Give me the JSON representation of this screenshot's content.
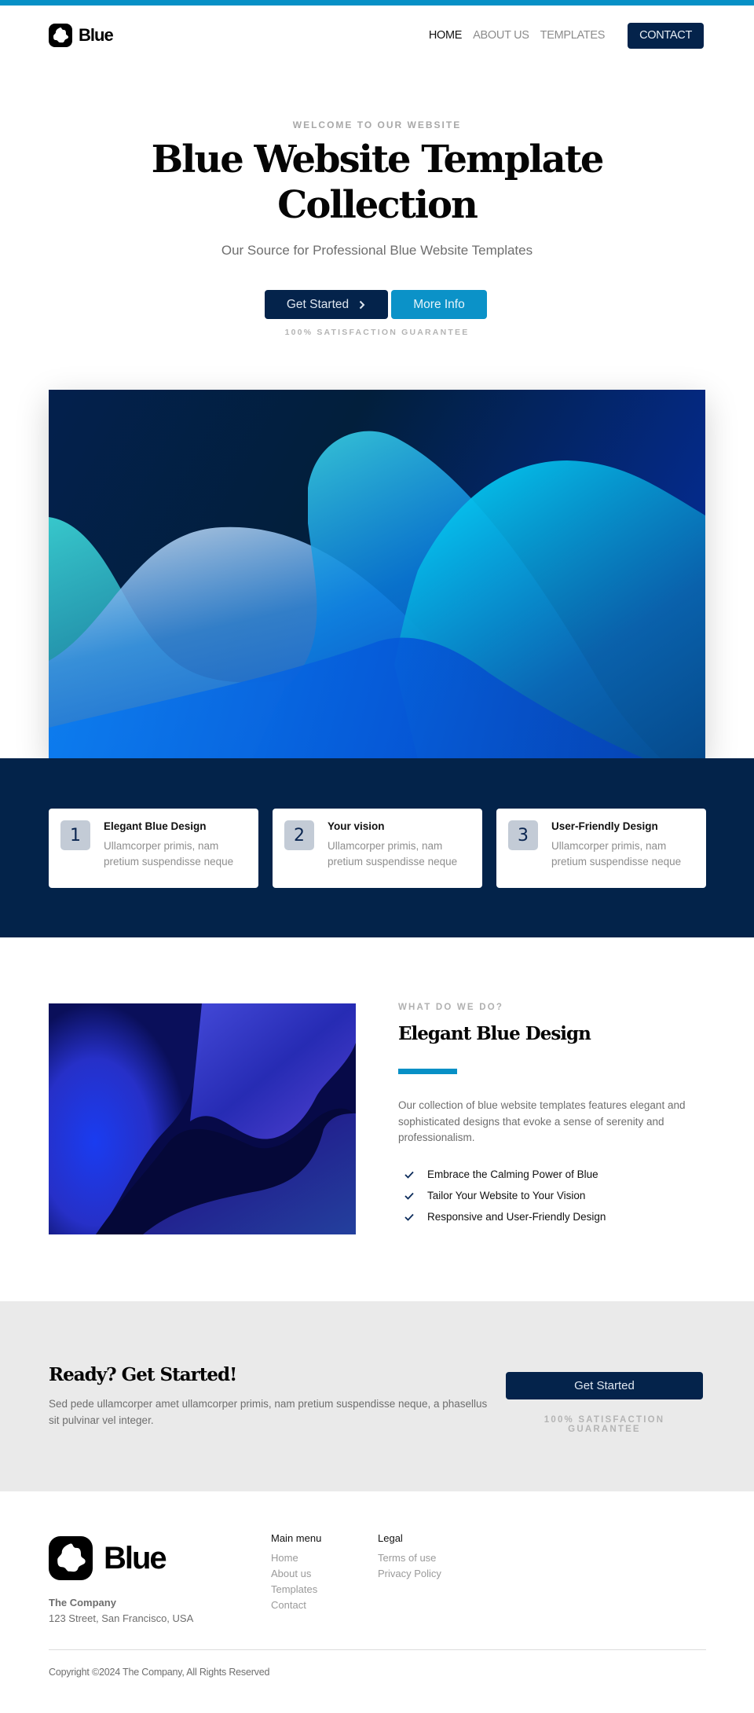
{
  "colors": {
    "accent": "#0790c6",
    "navy": "#04234b",
    "band": "#03234a",
    "cta_bg": "#eaeaea"
  },
  "header": {
    "logo_text": "Blue",
    "logo_icon": "logo-mark-icon",
    "nav": [
      {
        "label": "HOME",
        "active": true
      },
      {
        "label": "ABOUT US",
        "active": false
      },
      {
        "label": "TEMPLATES",
        "active": false
      }
    ],
    "contact_label": "CONTACT"
  },
  "hero": {
    "eyebrow": "WELCOME TO OUR WEBSITE",
    "title_line1": "Blue Website Template",
    "title_line2": "Collection",
    "subtitle": "Our Source for Professional Blue Website Templates",
    "primary_button": "Get Started",
    "primary_icon": "chevron-right-icon",
    "secondary_button": "More Info",
    "guarantee": "100% SATISFACTION GUARANTEE"
  },
  "features": [
    {
      "number": "1",
      "title": "Elegant Blue Design",
      "description": "Ullamcorper primis, nam pretium suspendisse neque"
    },
    {
      "number": "2",
      "title": "Your vision",
      "description": "Ullamcorper primis, nam pretium suspendisse neque"
    },
    {
      "number": "3",
      "title": "User-Friendly Design",
      "description": "Ullamcorper primis, nam pretium suspendisse neque"
    }
  ],
  "about": {
    "eyebrow": "WHAT DO WE DO?",
    "title": "Elegant Blue Design",
    "text": "Our collection of blue website templates features elegant and sophisticated designs that evoke a sense of serenity and professionalism.",
    "checklist": [
      "Embrace the Calming Power of Blue",
      "Tailor Your Website to Your Vision",
      "Responsive and User-Friendly Design"
    ]
  },
  "cta": {
    "title": "Ready? Get Started!",
    "text": "Sed pede ullamcorper amet ullamcorper primis, nam pretium suspendisse neque, a phasellus sit pulvinar vel integer.",
    "button": "Get Started",
    "guarantee": "100% SATISFACTION GUARANTEE"
  },
  "footer": {
    "logo_text": "Blue",
    "company_name": "The Company",
    "company_address": "123 Street, San Francisco, USA",
    "main_menu": {
      "title": "Main menu",
      "links": [
        "Home",
        "About us",
        "Templates",
        "Contact"
      ]
    },
    "legal": {
      "title": "Legal",
      "links": [
        "Terms of use",
        "Privacy Policy"
      ]
    },
    "copyright": "Copyright ©2024 The Company, All Rights Reserved"
  }
}
